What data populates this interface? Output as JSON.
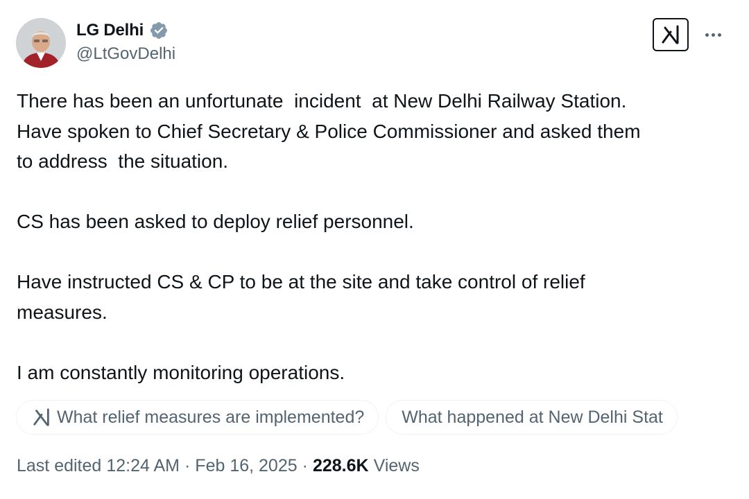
{
  "header": {
    "display_name": "LG Delhi",
    "handle": "@LtGovDelhi",
    "verified_icon": "verified-badge-icon",
    "grok_icon": "grok-icon",
    "more_icon": "more-options-icon"
  },
  "tweet": {
    "paragraphs": [
      "There has been an unfortunate  incident  at New Delhi Railway Station.\nHave spoken to Chief Secretary & Police Commissioner and asked them\nto address  the situation.",
      "CS has been asked to deploy relief personnel.",
      "Have instructed CS & CP to be at the site and take control of relief\nmeasures.",
      "I am constantly monitoring operations."
    ]
  },
  "grok_suggestions": [
    "What relief measures are implemented?",
    "What happened at New Delhi Stat"
  ],
  "meta": {
    "edited_label": "Last edited",
    "time": "12:24 AM",
    "date": "Feb 16, 2025",
    "views_count": "228.6K",
    "views_label": "Views",
    "separator": "·"
  },
  "colors": {
    "text_primary": "#0f1419",
    "text_secondary": "#536471",
    "verified": "#829aab",
    "chip_border": "#eff3f4"
  }
}
